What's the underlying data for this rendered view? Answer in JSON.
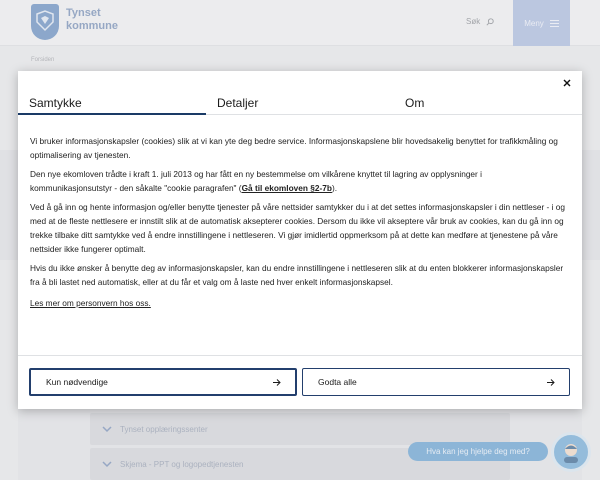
{
  "header": {
    "logo_text": "Tynset\nkommune",
    "search_label": "Søk",
    "menu_label": "Meny"
  },
  "breadcrumb": "Forsiden",
  "accordions": [
    {
      "label": "Tynset opplæringssenter"
    },
    {
      "label": "Skjema - PPT og logopedtjenesten"
    }
  ],
  "chat": {
    "prompt": "Hva kan jeg hjelpe deg med?"
  },
  "modal": {
    "tabs": [
      "Samtykke",
      "Detaljer",
      "Om"
    ],
    "active_tab": 0,
    "paragraph1": "Vi bruker informasjonskapsler (cookies) slik at vi kan yte deg bedre service. Informasjonskapslene blir hovedsakelig benyttet for trafikkmåling og optimalisering av tjenesten.",
    "paragraph2_before": "Den nye ekomloven trådte i kraft 1. juli 2013 og har fått en ny bestemmelse om vilkårene knyttet til lagring av opplysninger i kommunikasjonsutstyr - den såkalte \"cookie paragrafen\" (",
    "paragraph2_link": "Gå til ekomloven §2-7b",
    "paragraph2_after": ").",
    "paragraph3": "Ved å gå inn og hente informasjon og/eller benytte tjenester på våre nettsider samtykker du i at det settes informasjonskapsler i din nettleser - i og med at de fleste nettlesere er innstilt slik at de automatisk aksepterer cookies. Dersom du ikke vil akseptere vår bruk av cookies, kan du gå inn og trekke tilbake ditt samtykke ved å endre innstillingene i nettleseren. Vi gjør imidlertid oppmerksom på at dette kan medføre at tjenestene på våre nettsider ikke fungerer optimalt.",
    "paragraph4": "Hvis du ikke ønsker å benytte deg av informasjonskapsler, kan du endre innstillingene i nettleseren slik at du enten blokkerer informasjonskapsler fra å bli lastet ned automatisk, eller at du får et valg om å laste ned hver enkelt informasjonskapsel.",
    "privacy_link": "Les mer om personvern hos oss.",
    "buttons": {
      "necessary": "Kun nødvendige",
      "accept_all": "Godta alle"
    }
  },
  "colors": {
    "accent": "#1a3a66",
    "menu_bg": "#a7b8dd",
    "chat_bg": "#5f9dd0"
  }
}
